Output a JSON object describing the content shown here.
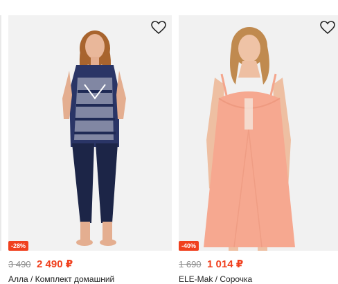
{
  "products": [
    {
      "badge": "-28%",
      "old_price": "3 490",
      "new_price": "2 490 ₽",
      "title": "Алла / Комплект домашний"
    },
    {
      "badge": "-40%",
      "old_price": "1 690",
      "new_price": "1 014 ₽",
      "title": "ELE-Mak / Сорочка"
    }
  ],
  "icons": {
    "favorite": "heart-outline-icon"
  },
  "colors": {
    "sale": "#f0401e",
    "old_price": "#8c8c8c"
  }
}
